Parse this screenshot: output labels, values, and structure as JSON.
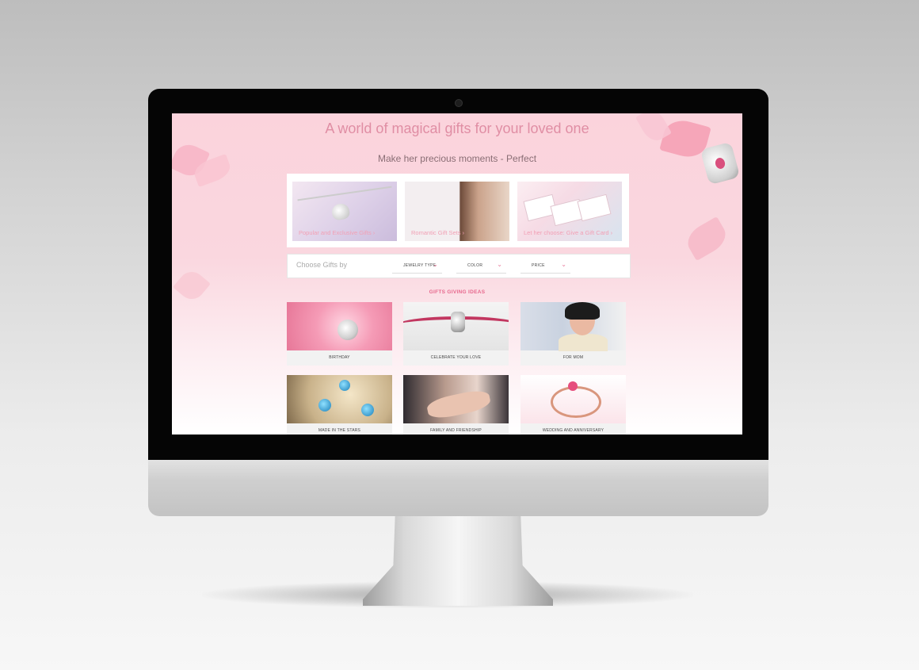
{
  "hero": {
    "title": "A world of magical gifts for your loved one",
    "subtitle": "Make her precious moments - Perfect"
  },
  "features": [
    {
      "label": "Popular and Exclusive Gifts",
      "icon": "chevron-right-icon"
    },
    {
      "label": "Romantic Gift Sets",
      "icon": "chevron-right-icon"
    },
    {
      "label": "Let her choose: Give a Gift Card",
      "icon": "chevron-right-icon"
    }
  ],
  "filters": {
    "label": "Choose Gifts by",
    "selects": [
      {
        "label": "JEWELRY TYPE",
        "icon": "chevron-down-icon"
      },
      {
        "label": "COLOR",
        "icon": "chevron-down-icon"
      },
      {
        "label": "PRICE",
        "icon": "chevron-down-icon"
      }
    ]
  },
  "gifts_section": {
    "title": "GIFTS GIVING IDEAS",
    "items": [
      {
        "label": "BIRTHDAY"
      },
      {
        "label": "CELEBRATE YOUR LOVE"
      },
      {
        "label": "FOR MOM"
      },
      {
        "label": "MADE IN THE STARS"
      },
      {
        "label": "FAMILY AND FRIENDSHIP"
      },
      {
        "label": "WEDDING AND ANNIVERSARY"
      }
    ]
  },
  "colors": {
    "accent": "#e7688d",
    "hero_text": "#e08ea4",
    "tile_label": "#f2a0b5"
  }
}
